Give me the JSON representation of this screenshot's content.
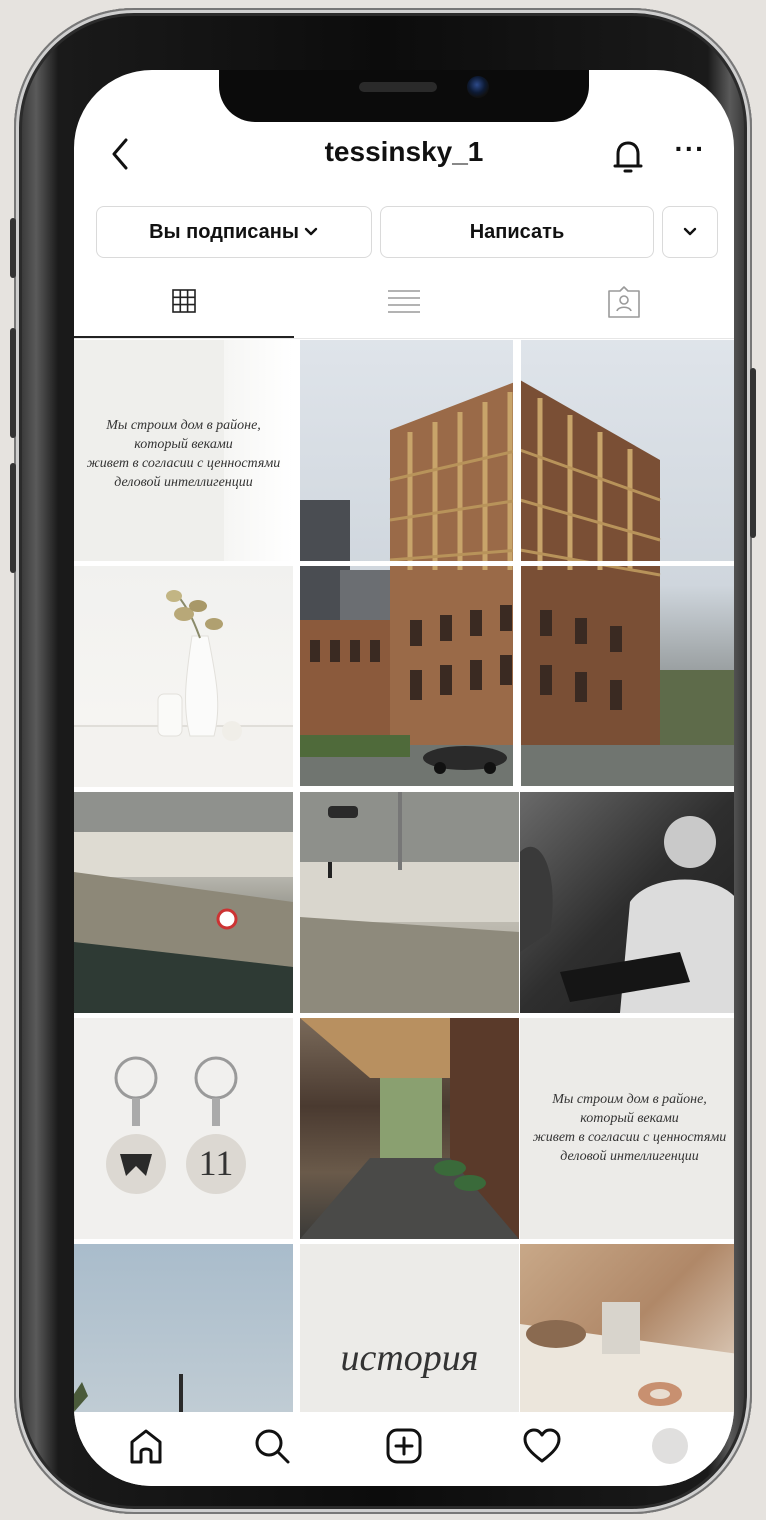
{
  "profile": {
    "username": "tessinsky_1",
    "more_label": "···"
  },
  "actions": {
    "following_label": "Вы подписаны",
    "message_label": "Написать"
  },
  "tabs": [
    {
      "icon": "grid-icon",
      "active": true
    },
    {
      "icon": "list-icon",
      "active": false
    },
    {
      "icon": "tagged-icon",
      "active": false
    }
  ],
  "posts": {
    "quote_1": [
      "Мы строим дом в районе,",
      "который веками",
      "живет в согласии с ценностями",
      "деловой интеллигенции"
    ],
    "keychain_number": "11",
    "quote_2": [
      "Мы строим дом в районе,",
      "который веками",
      "живет в согласии с ценностями",
      "деловой интеллигенции"
    ],
    "history_label": "история"
  },
  "bottom_nav": [
    "home-icon",
    "search-icon",
    "new-post-icon",
    "activity-icon",
    "profile-avatar"
  ],
  "colors": {
    "accent": "#111111",
    "border": "#dadada",
    "brick": "#8b5a3c"
  }
}
